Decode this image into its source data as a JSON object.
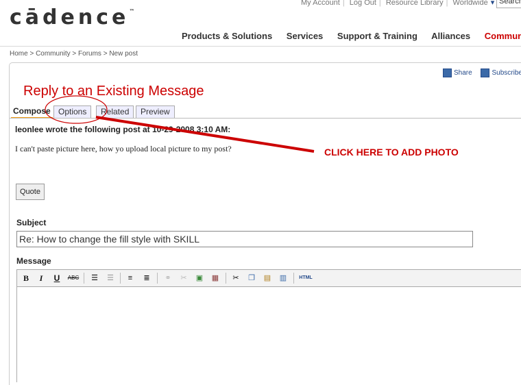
{
  "header": {
    "utility_links": [
      "My Account",
      "Log Out",
      "Resource Library",
      "Worldwide"
    ],
    "search_label": "Search",
    "logo_text": "cādence",
    "trademark": "™"
  },
  "nav": {
    "items": [
      "Products & Solutions",
      "Services",
      "Support & Training",
      "Alliances",
      "Community"
    ],
    "active": "Community"
  },
  "breadcrumb": "Home > Community > Forums > New post",
  "actions": {
    "share": "Share",
    "subscribe": "Subscribe"
  },
  "page_title": "Reply to an Existing Message",
  "tabs": [
    "Compose",
    "Options",
    "Related",
    "Preview"
  ],
  "post": {
    "meta": "leonlee wrote the following post at 10-29-2008 3:10 AM:",
    "text": "I can't paste picture here, how yo upload local picture to my post?"
  },
  "quote_button": "Quote",
  "subject": {
    "label": "Subject",
    "value": "Re: How to change the fill style with SKILL"
  },
  "message": {
    "label": "Message"
  },
  "toolbar": {
    "bold": "B",
    "italic": "I",
    "underline": "U",
    "strike": "ABC",
    "html": "HTML"
  },
  "annotation": {
    "text": "CLICK HERE TO ADD PHOTO",
    "color": "#cc0000"
  },
  "colors": {
    "accent": "#cc0000",
    "link": "#244a8a",
    "tab_underline": "#f39c12"
  }
}
